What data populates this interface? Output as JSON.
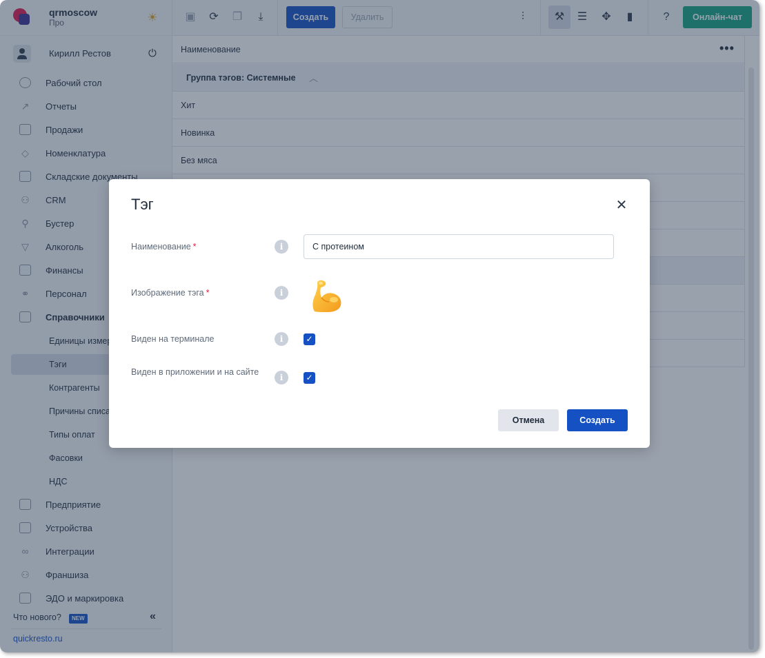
{
  "brand": {
    "name": "qrmoscow",
    "plan": "Про"
  },
  "user": {
    "name": "Кирилл Рестов"
  },
  "nav": {
    "items": [
      {
        "label": "Рабочий стол"
      },
      {
        "label": "Отчеты"
      },
      {
        "label": "Продажи"
      },
      {
        "label": "Номенклатура"
      },
      {
        "label": "Складские документы"
      },
      {
        "label": "CRM"
      },
      {
        "label": "Бустер"
      },
      {
        "label": "Алкоголь"
      },
      {
        "label": "Финансы"
      },
      {
        "label": "Персонал"
      },
      {
        "label": "Справочники"
      }
    ],
    "sub_items": [
      {
        "label": "Единицы измерения"
      },
      {
        "label": "Тэги"
      },
      {
        "label": "Контрагенты"
      },
      {
        "label": "Причины списания"
      },
      {
        "label": "Типы оплат"
      },
      {
        "label": "Фасовки"
      },
      {
        "label": "НДС"
      }
    ],
    "bottom_items": [
      {
        "label": "Предприятие"
      },
      {
        "label": "Устройства"
      },
      {
        "label": "Интеграции"
      },
      {
        "label": "Франшиза"
      },
      {
        "label": "ЭДО и маркировка"
      }
    ],
    "active_sub": "Тэги"
  },
  "news": {
    "label": "Что нового?",
    "badge": "NEW"
  },
  "site_link": "quickresto.ru",
  "toolbar": {
    "create_label": "Создать",
    "delete_label": "Удалить",
    "chat_label": "Онлайн-чат"
  },
  "table": {
    "header": "Наименование",
    "group_label": "Группа тэгов: Системные",
    "rows": [
      "Хит",
      "Новинка",
      "Без мяса"
    ]
  },
  "modal": {
    "title": "Тэг",
    "fields": {
      "name_label": "Наименование",
      "name_value": "С протеином",
      "image_label": "Изображение тэга",
      "terminal_label": "Виден на терминале",
      "app_label": "Виден в приложении и на сайте"
    },
    "required_mark": "*",
    "info_glyph": "i",
    "check_glyph": "✓",
    "cancel_label": "Отмена",
    "create_label": "Создать"
  },
  "colors": {
    "accent": "#1551c3",
    "chat": "#14a37f",
    "required": "#e0163c"
  }
}
